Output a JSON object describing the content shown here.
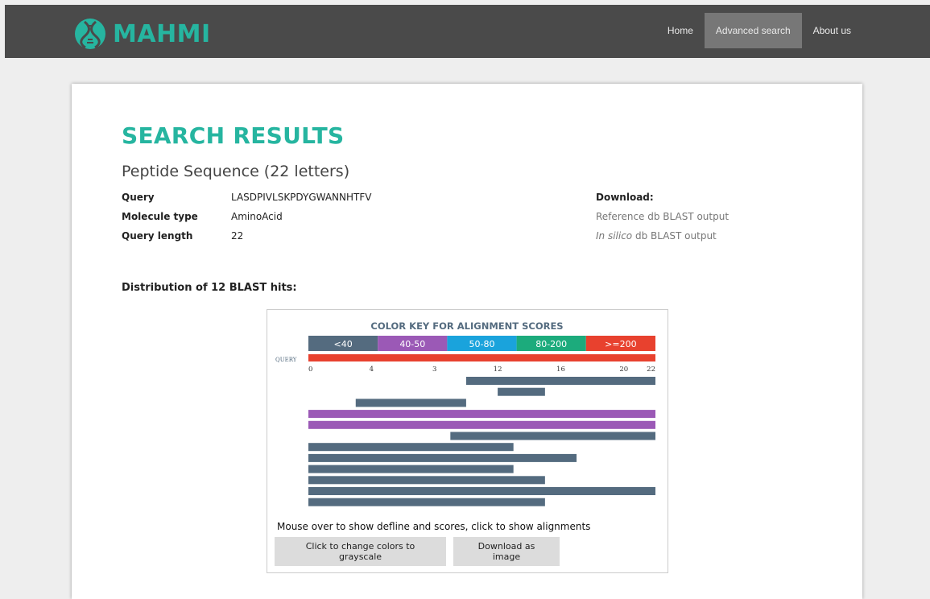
{
  "app": {
    "name": "MAHMI",
    "brand_color": "#26b5a0"
  },
  "nav": {
    "items": [
      {
        "label": "Home",
        "active": false
      },
      {
        "label": "Advanced search",
        "active": true
      },
      {
        "label": "About us",
        "active": false
      }
    ]
  },
  "page": {
    "title": "SEARCH RESULTS",
    "subtitle": "Peptide Sequence (22 letters)"
  },
  "query_info": [
    {
      "label": "Query",
      "value": "LASDPIVLSKPDYGWANNHTFV"
    },
    {
      "label": "Molecule type",
      "value": "AminoAcid"
    },
    {
      "label": "Query length",
      "value": "22"
    }
  ],
  "download": {
    "title": "Download:",
    "reference_link": "Reference db BLAST output",
    "insilico_italic": "In silico",
    "insilico_rest": " db BLAST output"
  },
  "distribution_title": "Distribution of 12 BLAST hits:",
  "graphic": {
    "color_key_title": "COLOR KEY FOR ALIGNMENT SCORES",
    "score_bins": [
      {
        "label": "<40",
        "color": "#546b7f"
      },
      {
        "label": "40-50",
        "color": "#9b59b6"
      },
      {
        "label": "50-80",
        "color": "#1aa3dc"
      },
      {
        "label": "80-200",
        "color": "#1cab7c"
      },
      {
        "label": ">=200",
        "color": "#e8412e"
      }
    ],
    "query_label": "QUERY",
    "query_color": "#e8412e",
    "axis_ticks": [
      "0",
      "4",
      "3",
      "12",
      "16",
      "20",
      "22"
    ],
    "axis_tick_values": [
      0,
      4,
      8,
      12,
      16,
      20,
      22
    ],
    "query_length": 22,
    "hits": [
      {
        "start": 10,
        "end": 22,
        "bin": 0
      },
      {
        "start": 12,
        "end": 15,
        "bin": 0
      },
      {
        "start": 3,
        "end": 10,
        "bin": 0
      },
      {
        "start": 0,
        "end": 22,
        "bin": 1
      },
      {
        "start": 0,
        "end": 22,
        "bin": 1
      },
      {
        "start": 9,
        "end": 22,
        "bin": 0
      },
      {
        "start": 0,
        "end": 13,
        "bin": 0
      },
      {
        "start": 0,
        "end": 17,
        "bin": 0
      },
      {
        "start": 0,
        "end": 13,
        "bin": 0
      },
      {
        "start": 0,
        "end": 15,
        "bin": 0
      },
      {
        "start": 0,
        "end": 22,
        "bin": 0
      },
      {
        "start": 0,
        "end": 15,
        "bin": 0
      }
    ],
    "hint": "Mouse over to show defline and scores, click to show alignments",
    "grayscale_button": "Click to change colors to grayscale",
    "download_image_button": "Download as image"
  }
}
